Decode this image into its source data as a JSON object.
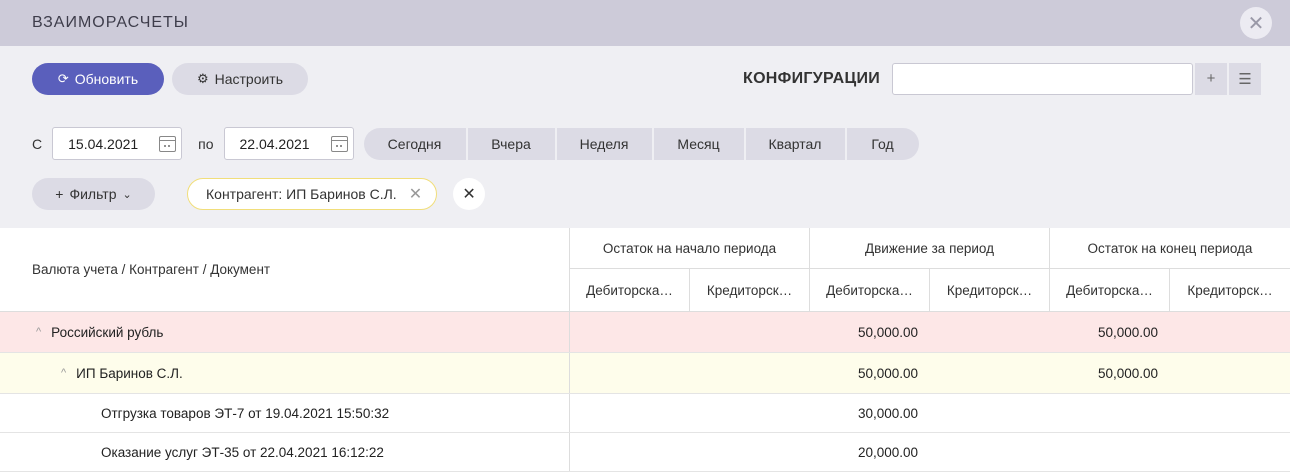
{
  "header": {
    "title": "ВЗАИМОРАСЧЕТЫ",
    "close_icon": "close-icon"
  },
  "toolbar": {
    "refresh_label": "Обновить",
    "settings_label": "Настроить",
    "config_label": "КОНФИГУРАЦИИ",
    "config_value": ""
  },
  "filters": {
    "from_label": "С",
    "from_date": "15.04.2021",
    "to_label": "по",
    "to_date": "22.04.2021",
    "periods": [
      "Сегодня",
      "Вчера",
      "Неделя",
      "Месяц",
      "Квартал",
      "Год"
    ],
    "filter_label": "Фильтр",
    "chip_text": "Контрагент: ИП Баринов С.Л."
  },
  "table": {
    "main_header": "Валюта учета / Контрагент / Документ",
    "groups": [
      "Остаток на начало периода",
      "Движение за период",
      "Остаток на конец периода"
    ],
    "subheaders": [
      "Дебиторска…",
      "Кредиторск…",
      "Дебиторска…",
      "Кредиторск…",
      "Дебиторска…",
      "Кредиторск…"
    ],
    "rows": [
      {
        "label": "Российский рубль",
        "level": 0,
        "caret": "^",
        "values": [
          "",
          "",
          "50,000.00",
          "",
          "50,000.00",
          ""
        ]
      },
      {
        "label": "ИП Баринов С.Л.",
        "level": 1,
        "caret": "^",
        "values": [
          "",
          "",
          "50,000.00",
          "",
          "50,000.00",
          ""
        ]
      },
      {
        "label": "Отгрузка товаров ЭТ-7 от 19.04.2021 15:50:32",
        "level": 2,
        "caret": "",
        "values": [
          "",
          "",
          "30,000.00",
          "",
          "",
          ""
        ]
      },
      {
        "label": "Оказание услуг ЭТ-35 от 22.04.2021 16:12:22",
        "level": 2,
        "caret": "",
        "values": [
          "",
          "",
          "20,000.00",
          "",
          "",
          ""
        ]
      }
    ]
  }
}
